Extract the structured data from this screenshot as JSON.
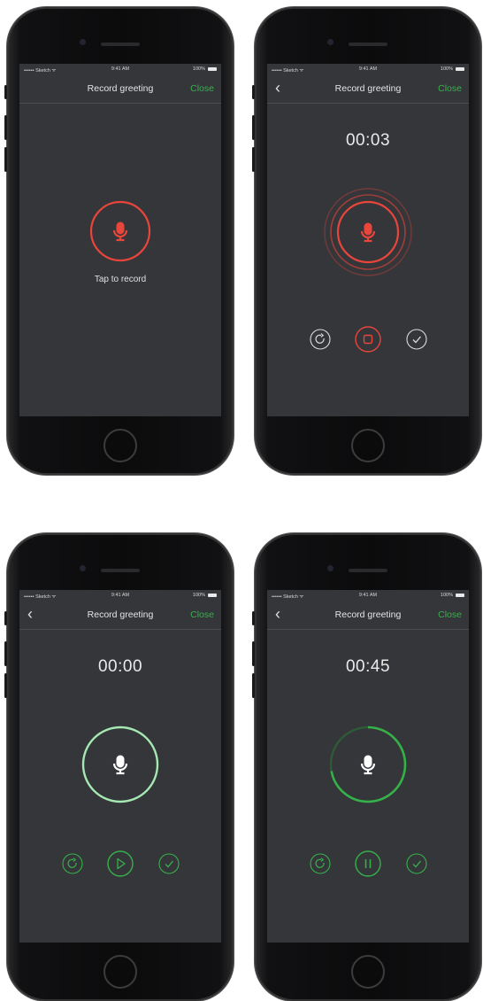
{
  "colors": {
    "screen_bg": "#34363a",
    "record_red": "#e8453b",
    "accent_green": "#36b14a",
    "ring_light_green": "#8fe3a0",
    "text": "#e4e4e4"
  },
  "statusbar": {
    "carrier": "•••••• Sketch ᯤ",
    "time": "9:41 AM",
    "battery": "100%"
  },
  "screens": [
    {
      "state": "idle",
      "title": "Record greeting",
      "close_label": "Close",
      "mic_icon": "microphone-icon",
      "tap_label": "Tap to record"
    },
    {
      "state": "recording",
      "title": "Record greeting",
      "close_label": "Close",
      "back_icon": "chevron-left-icon",
      "timer": "00:03",
      "mic_icon": "microphone-icon",
      "controls": [
        "redo-icon",
        "stop-icon",
        "check-icon"
      ]
    },
    {
      "state": "playback-ready",
      "title": "Record greeting",
      "close_label": "Close",
      "back_icon": "chevron-left-icon",
      "timer": "00:00",
      "mic_icon": "microphone-icon",
      "controls": [
        "redo-icon",
        "play-icon",
        "check-icon"
      ]
    },
    {
      "state": "playing",
      "title": "Record greeting",
      "close_label": "Close",
      "back_icon": "chevron-left-icon",
      "timer": "00:45",
      "progress": 0.72,
      "mic_icon": "microphone-icon",
      "controls": [
        "redo-icon",
        "pause-icon",
        "check-icon"
      ]
    }
  ]
}
